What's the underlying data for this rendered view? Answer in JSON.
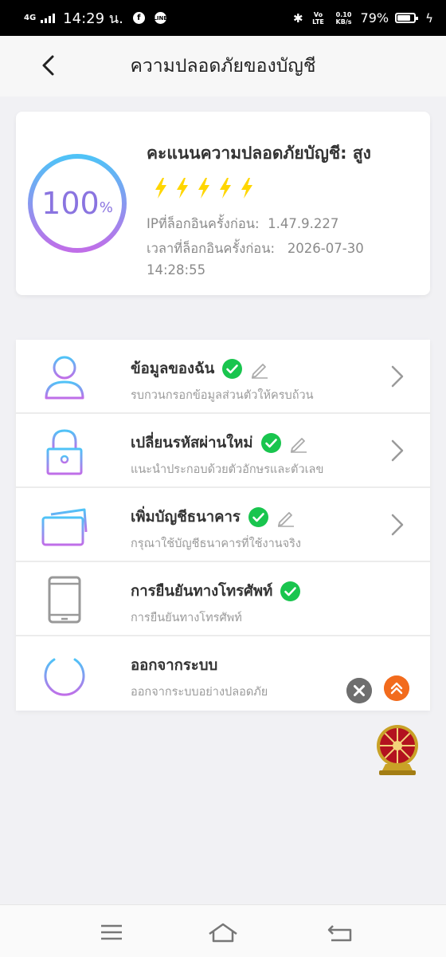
{
  "status_bar": {
    "network": "4G",
    "time": "14:29 น.",
    "volte": "Vo LTE",
    "speed": "0.10 KB/s",
    "battery": "79%",
    "battery_level": 0.79
  },
  "header": {
    "title": "ความปลอดภัยของบัญชี"
  },
  "security_card": {
    "percent_value": "100",
    "percent_sign": "%",
    "score_title": "คะแนนความปลอดภัยบัญชี: สูง",
    "bolt_count": 5,
    "ip_label": "IPที่ล็อกอินครั้งก่อน:",
    "ip_value": "1.47.9.227",
    "time_label": "เวลาที่ล็อกอินครั้งก่อน:",
    "time_date": "2026-07-30",
    "time_clock": "14:28:55"
  },
  "menu": [
    {
      "title": "ข้อมูลของฉัน",
      "subtitle": "รบกวนกรอกข้อมูลส่วนตัวให้ครบถ้วน",
      "icon": "user-icon",
      "verified": true,
      "editable": true
    },
    {
      "title": "เปลี่ยนรหัสผ่านใหม่",
      "subtitle": "แนะนำประกอบด้วยตัวอักษรและตัวเลข",
      "icon": "lock-icon",
      "verified": true,
      "editable": true
    },
    {
      "title": "เพิ่มบัญชีธนาคาร",
      "subtitle": "กรุณาใช้บัญชีธนาคารที่ใช้งานจริง",
      "icon": "bank-card-icon",
      "verified": true,
      "editable": true
    },
    {
      "title": "การยืนยันทางโทรศัพท์",
      "subtitle": "การยืนยันทางโทรศัพท์",
      "icon": "phone-icon",
      "verified": true,
      "editable": false
    },
    {
      "title": "ออกจากระบบ",
      "subtitle": "ออกจากระบบอย่างปลอดภัย",
      "icon": "power-icon",
      "verified": false,
      "editable": false
    }
  ],
  "colors": {
    "gradient_start": "#4fc3f7",
    "gradient_end": "#c06ee8",
    "check_green": "#19c54e",
    "bolt_yellow": "#ffd600",
    "float_orange": "#f26b1d"
  }
}
